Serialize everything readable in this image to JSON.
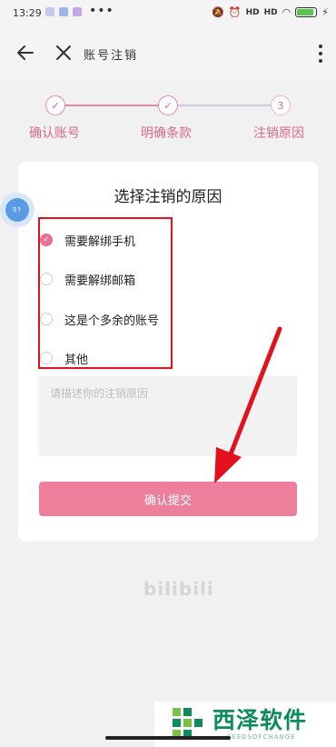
{
  "status_bar": {
    "time": "13:29",
    "dots": "•••",
    "signal_1": "HD",
    "signal_2": "HD",
    "battery_level": 0.88
  },
  "app_bar": {
    "title": "账号注销"
  },
  "steps": [
    {
      "label": "确认账号",
      "state": "done"
    },
    {
      "label": "明确条款",
      "state": "done"
    },
    {
      "label": "注销原因",
      "state": "current",
      "number": "3"
    }
  ],
  "card": {
    "title": "选择注销的原因",
    "options": [
      {
        "label": "需要解绑手机",
        "checked": true
      },
      {
        "label": "需要解绑邮箱",
        "checked": false
      },
      {
        "label": "这是个多余的账号",
        "checked": false
      },
      {
        "label": "其他",
        "checked": false
      }
    ],
    "reason_placeholder": "请描述你的注销原因",
    "submit_label": "确认提交"
  },
  "float_bubble_text": "5↑",
  "brand_logo": "bilibili",
  "watermark": {
    "title": "西泽软件",
    "subtitle": "SEEDSOFCHANGE"
  },
  "colors": {
    "accent": "#e77094",
    "submit": "#ee7f9c",
    "highlight_box": "#e3101e",
    "arrow": "#e3101e"
  }
}
